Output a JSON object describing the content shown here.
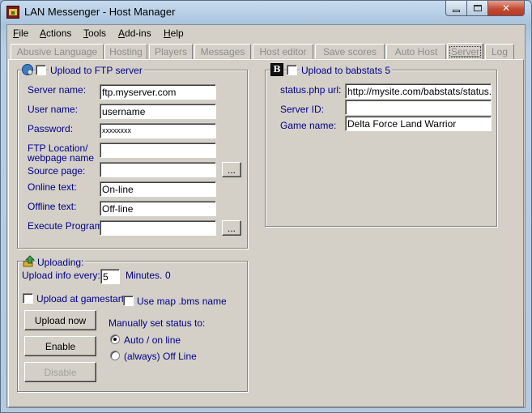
{
  "window": {
    "title": "LAN Messenger - Host Manager"
  },
  "menu": [
    "File",
    "Actions",
    "Tools",
    "Add-ins",
    "Help"
  ],
  "tabs": [
    "Abusive Language",
    "Hosting",
    "Players",
    "Messages",
    "Host editor",
    "Save scores",
    "Auto Host",
    "Server",
    "Log"
  ],
  "active_tab": "Server",
  "ftp": {
    "upload_label": "Upload to FTP server",
    "upload_checked": false,
    "server_name_label": "Server name:",
    "server_name_value": "ftp.myserver.com",
    "user_name_label": "User name:",
    "user_name_value": "username",
    "password_label": "Password:",
    "password_value": "xxxxxxxx",
    "ftp_location_label": "FTP Location/ webpage name",
    "ftp_location_value": "",
    "source_page_label": "Source page:",
    "source_page_value": "",
    "browse_label": "...",
    "online_text_label": "Online text:",
    "online_text_value": "On-line",
    "offline_text_label": "Offline text:",
    "offline_text_value": "Off-line",
    "execute_program_label": "Execute Program:",
    "execute_program_value": ""
  },
  "babstats": {
    "upload_label": "Upload to babstats 5",
    "upload_checked": false,
    "status_url_label": "status.php url:",
    "status_url_value": "http://mysite.com/babstats/status.ph",
    "server_id_label": "Server ID:",
    "server_id_value": "",
    "game_name_label": "Game name:",
    "game_name_value": "Delta Force Land Warrior"
  },
  "uploading": {
    "title": "Uploading:",
    "upload_every_label": "Upload info every:",
    "upload_every_value": "5",
    "minutes_label": "Minutes.",
    "minutes_count": "0",
    "upload_at_gamestart_label": "Upload at gamestart",
    "use_map_name_label": "Use map .bms name",
    "upload_now_label": "Upload now",
    "enable_label": "Enable",
    "disable_label": "Disable",
    "manual_status_label": "Manually set status to:",
    "status_options": [
      "Auto / on line",
      "(always) Off Line"
    ],
    "status_selected": "Auto / on line"
  }
}
